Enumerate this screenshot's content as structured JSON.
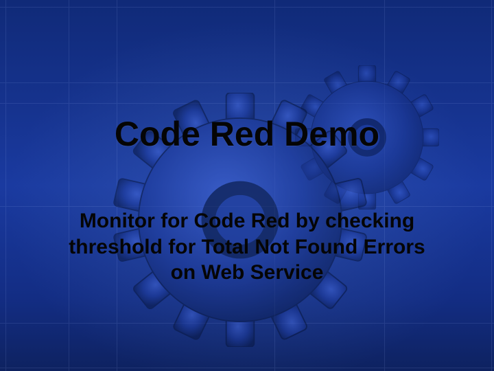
{
  "slide": {
    "title": "Code Red Demo",
    "subtitle": "Monitor for Code Red by checking threshold for Total Not Found Errors on Web Service"
  }
}
